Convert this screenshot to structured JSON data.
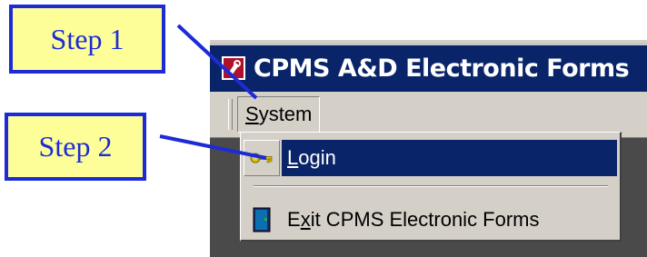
{
  "window": {
    "title": "CPMS A&D Electronic Forms",
    "icon": "forms-app-icon"
  },
  "menu_bar": {
    "system": {
      "label_prefix": "",
      "label_accel": "S",
      "label_rest": "ystem"
    }
  },
  "dropdown": {
    "login": {
      "icon": "key-icon",
      "label_accel": "L",
      "label_rest": "ogin",
      "highlighted": true
    },
    "exit": {
      "icon": "exit-door-icon",
      "label_prefix": "E",
      "label_accel": "x",
      "label_rest": "it CPMS Electronic Forms"
    }
  },
  "callouts": {
    "step1": "Step 1",
    "step2": "Step 2"
  },
  "colors": {
    "title_bar": "#0a246a",
    "menu_highlight": "#0a246a",
    "callout_fill": "#fefe99",
    "callout_border": "#1c2bd6"
  }
}
